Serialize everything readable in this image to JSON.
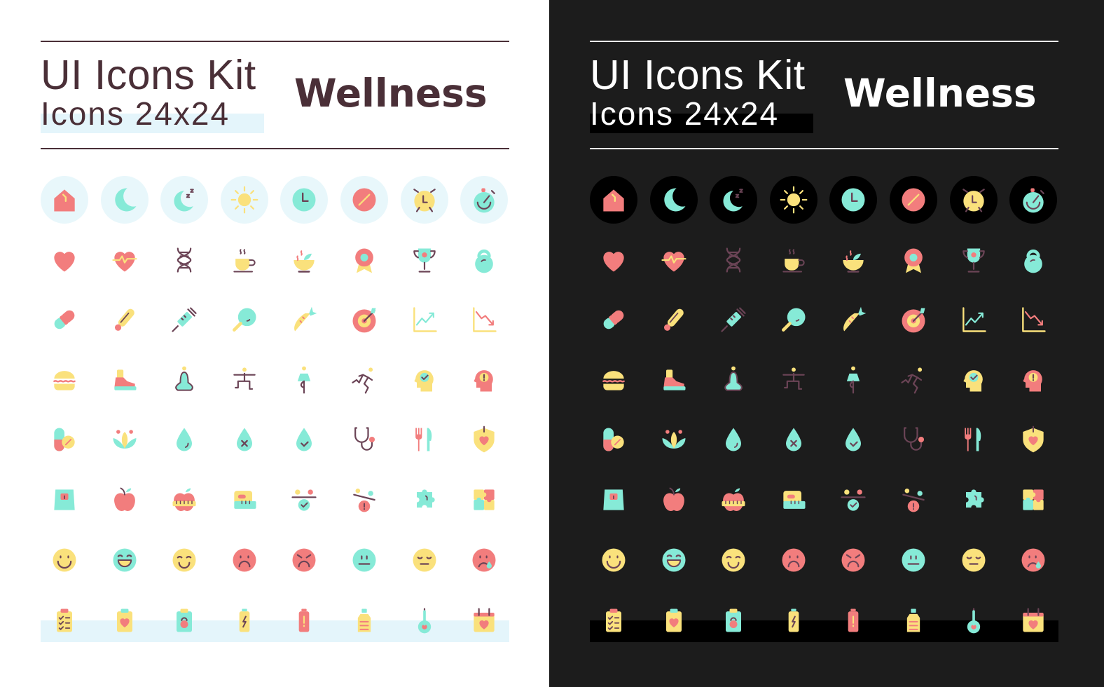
{
  "header": {
    "title": "UI Icons Kit",
    "subtitle": "Icons 24x24",
    "theme": "Wellness"
  },
  "colors": {
    "red": "#f27d7d",
    "teal": "#86ead7",
    "yellow": "#fae17c",
    "plum": "#6b4456",
    "light_bg": "#ffffff",
    "dark_bg": "#1c1c1c",
    "light_accent_bg": "#e4f5fb",
    "text_light": "#4a2f37"
  },
  "panels": [
    "light",
    "dark"
  ],
  "icons": [
    [
      "home",
      "moon",
      "sleep",
      "sun",
      "clock",
      "pill-tablet",
      "alarm-clock",
      "stopwatch"
    ],
    [
      "heart",
      "heartbeat",
      "dna",
      "tea-cup",
      "healthy-bowl",
      "award-badge",
      "trophy",
      "kettlebell"
    ],
    [
      "capsule",
      "thermometer",
      "syringe",
      "lollipop",
      "carrot",
      "target",
      "chart-up",
      "chart-down"
    ],
    [
      "burger",
      "sneaker",
      "yoga-meditation",
      "yoga-stretch",
      "yoga-tree-pose",
      "running",
      "mental-health-check",
      "mental-health-alert"
    ],
    [
      "pills",
      "lotus",
      "water-drop",
      "water-drop-x",
      "water-drop-check",
      "stethoscope",
      "fork-knife",
      "health-shield"
    ],
    [
      "weight-scale",
      "apple",
      "apple-measure",
      "measuring-tape",
      "balance-check",
      "balance-alert",
      "puzzle-piece",
      "puzzle"
    ],
    [
      "smile",
      "laugh",
      "happy",
      "sad",
      "angry",
      "neutral",
      "calm",
      "crying"
    ],
    [
      "checklist",
      "clipboard-heart",
      "clipboard-kettlebell",
      "battery-charge",
      "battery-low",
      "water-bottle",
      "thermometer-low",
      "calendar-heart"
    ]
  ]
}
